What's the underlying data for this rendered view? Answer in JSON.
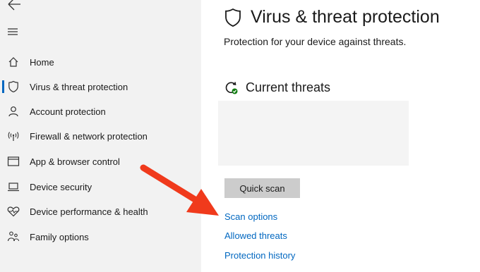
{
  "sidebar": {
    "back_icon": "back-arrow-icon",
    "menu_icon": "hamburger-menu-icon",
    "items": [
      {
        "label": "Home",
        "icon": "home-icon",
        "selected": false
      },
      {
        "label": "Virus & threat protection",
        "icon": "shield-icon",
        "selected": true
      },
      {
        "label": "Account protection",
        "icon": "person-icon",
        "selected": false
      },
      {
        "label": "Firewall & network protection",
        "icon": "wifi-antenna-icon",
        "selected": false
      },
      {
        "label": "App & browser control",
        "icon": "browser-window-icon",
        "selected": false
      },
      {
        "label": "Device security",
        "icon": "laptop-icon",
        "selected": false
      },
      {
        "label": "Device performance & health",
        "icon": "heart-icon",
        "selected": false
      },
      {
        "label": "Family options",
        "icon": "family-icon",
        "selected": false
      }
    ]
  },
  "main": {
    "title": "Virus & threat protection",
    "title_icon": "shield-icon",
    "subtitle": "Protection for your device against threats.",
    "section_title": "Current threats",
    "section_icon": "refresh-check-icon",
    "quick_scan_label": "Quick scan",
    "links": {
      "scan_options": "Scan options",
      "allowed_threats": "Allowed threats",
      "protection_history": "Protection history"
    }
  },
  "colors": {
    "accent": "#0067c0",
    "sidebar_bg": "#f2f2f2",
    "annotation_arrow": "#f03a1c",
    "status_ok": "#107c10"
  }
}
